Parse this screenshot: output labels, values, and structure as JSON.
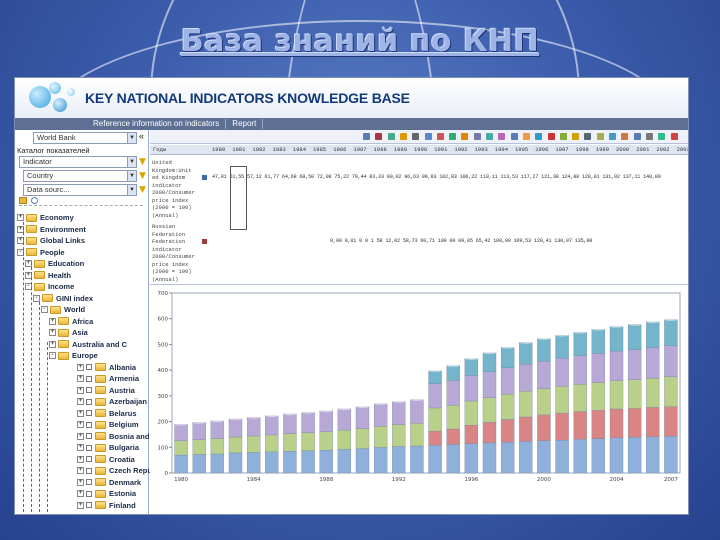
{
  "slide": {
    "title": "База знаний по КНП"
  },
  "app": {
    "name": "KEY NATIONAL INDICATORS KNOWLEDGE BASE",
    "menu": [
      "Reference information on indicators",
      "Report"
    ],
    "colors": {
      "header_text": "#123a7a",
      "menubar": "#5d6f93",
      "folder": "#e8b53a"
    }
  },
  "sidebar": {
    "source_select": "World Bank",
    "catalog_label": "Каталог показателей",
    "filters": [
      {
        "value": "Indicator"
      },
      {
        "value": "Country"
      },
      {
        "value": "Data sourc..."
      }
    ],
    "tree": [
      {
        "label": "Economy",
        "level": 0,
        "toggle": "+"
      },
      {
        "label": "Environment",
        "level": 0,
        "toggle": "+"
      },
      {
        "label": "Global Links",
        "level": 0,
        "toggle": "+"
      },
      {
        "label": "People",
        "level": 0,
        "toggle": "-"
      },
      {
        "label": "Education",
        "level": 1,
        "toggle": "+"
      },
      {
        "label": "Health",
        "level": 1,
        "toggle": "+"
      },
      {
        "label": "Income",
        "level": 1,
        "toggle": "-"
      },
      {
        "label": "GINI index",
        "level": 2,
        "toggle": "-"
      },
      {
        "label": "World",
        "level": 3,
        "toggle": "-"
      },
      {
        "label": "Africa",
        "level": 4,
        "toggle": "+"
      },
      {
        "label": "Asia",
        "level": 4,
        "toggle": "+"
      },
      {
        "label": "Australia and C",
        "level": 4,
        "toggle": "+"
      },
      {
        "label": "Europe",
        "level": 4,
        "toggle": "-"
      },
      {
        "label": "Albania",
        "level": 5,
        "toggle": "+"
      },
      {
        "label": "Armenia",
        "level": 5,
        "toggle": "+"
      },
      {
        "label": "Austria",
        "level": 5,
        "toggle": "+"
      },
      {
        "label": "Azerbaijan",
        "level": 5,
        "toggle": "+"
      },
      {
        "label": "Belarus",
        "level": 5,
        "toggle": "+"
      },
      {
        "label": "Belgium",
        "level": 5,
        "toggle": "+"
      },
      {
        "label": "Bosnia and",
        "level": 5,
        "toggle": "+"
      },
      {
        "label": "Bulgaria",
        "level": 5,
        "toggle": "+"
      },
      {
        "label": "Croatia",
        "level": 5,
        "toggle": "+"
      },
      {
        "label": "Czech Repu",
        "level": 5,
        "toggle": "+"
      },
      {
        "label": "Denmark",
        "level": 5,
        "toggle": "+"
      },
      {
        "label": "Estonia",
        "level": 5,
        "toggle": "+"
      },
      {
        "label": "Finland",
        "level": 5,
        "toggle": "+"
      }
    ]
  },
  "grid": {
    "corner_label": "Годы",
    "years": [
      "1980",
      "1981",
      "1982",
      "1983",
      "1984",
      "1985",
      "1986",
      "1987",
      "1988",
      "1989",
      "1990",
      "1991",
      "1992",
      "1993",
      "1994",
      "1995",
      "1996",
      "1997",
      "1998",
      "1999",
      "2000",
      "2001",
      "2002",
      "2003"
    ],
    "rows": [
      {
        "name": [
          "United",
          "Kingdom:Unit",
          "ed Kingdom",
          "indicator",
          "2008/Consumer",
          "price index",
          "(2000 = 100)",
          "(Annual)"
        ],
        "color": "#3d6bb0",
        "values": "47,81  51,55  57,12  61,77  64,68  68,50  72,08  75,22  79,44  83,33  90,02  96,63  99,83  102,83  106,22  110,11  113,53  117,27  121,38  124,88  128,01  131,92  137,11  140,89"
      },
      {
        "name": [
          "Russian",
          "Federation",
          "Federation",
          "indicator",
          "2008/Consumer",
          "price index",
          "(2000 = 100)",
          "(Annual)"
        ],
        "color": "#a03a3a",
        "values": "0,00  0,01  0  0  1  58  12,02  58,73  60,71  100  00  09,05  65,42  100,00  109,53  120,41  130,07  135,98"
      }
    ]
  },
  "chart_data": {
    "type": "bar",
    "stacked": true,
    "ylim": [
      0,
      700
    ],
    "yticks": [
      0,
      100,
      200,
      300,
      400,
      500,
      600,
      700
    ],
    "x": [
      1980,
      1981,
      1982,
      1983,
      1984,
      1985,
      1986,
      1987,
      1988,
      1989,
      1990,
      1991,
      1992,
      1993,
      1994,
      1995,
      1996,
      1997,
      1998,
      1999,
      2000,
      2001,
      2002,
      2003,
      2004,
      2005,
      2006,
      2007
    ],
    "xticks": [
      1980,
      1984,
      1988,
      1992,
      1996,
      2000,
      2004,
      2007
    ],
    "series": [
      {
        "color": "#8fb0da",
        "values": [
          70,
          72,
          74,
          78,
          80,
          82,
          85,
          87,
          89,
          92,
          95,
          100,
          103,
          105,
          108,
          111,
          114,
          117,
          120,
          123,
          126,
          128,
          131,
          134,
          137,
          139,
          141,
          143
        ]
      },
      {
        "color": "#d98585",
        "values": [
          0,
          0,
          0,
          0,
          0,
          0,
          0,
          0,
          0,
          0,
          0,
          0,
          0,
          0,
          55,
          60,
          72,
          80,
          88,
          95,
          100,
          105,
          108,
          110,
          112,
          112,
          114,
          115
        ]
      },
      {
        "color": "#b8d08a",
        "values": [
          55,
          58,
          60,
          62,
          64,
          66,
          68,
          70,
          72,
          75,
          78,
          82,
          85,
          88,
          90,
          92,
          94,
          96,
          98,
          100,
          102,
          104,
          106,
          108,
          110,
          112,
          114,
          116
        ]
      },
      {
        "color": "#b7a8d6",
        "values": [
          65,
          67,
          69,
          71,
          73,
          75,
          77,
          79,
          81,
          83,
          85,
          88,
          90,
          93,
          95,
          97,
          99,
          101,
          103,
          105,
          107,
          109,
          111,
          113,
          115,
          117,
          119,
          121
        ]
      },
      {
        "color": "#74b5cc",
        "values": [
          0,
          0,
          0,
          0,
          0,
          0,
          0,
          0,
          0,
          0,
          0,
          0,
          0,
          0,
          50,
          58,
          66,
          74,
          80,
          85,
          88,
          90,
          92,
          94,
          96,
          98,
          100,
          102
        ]
      }
    ]
  }
}
